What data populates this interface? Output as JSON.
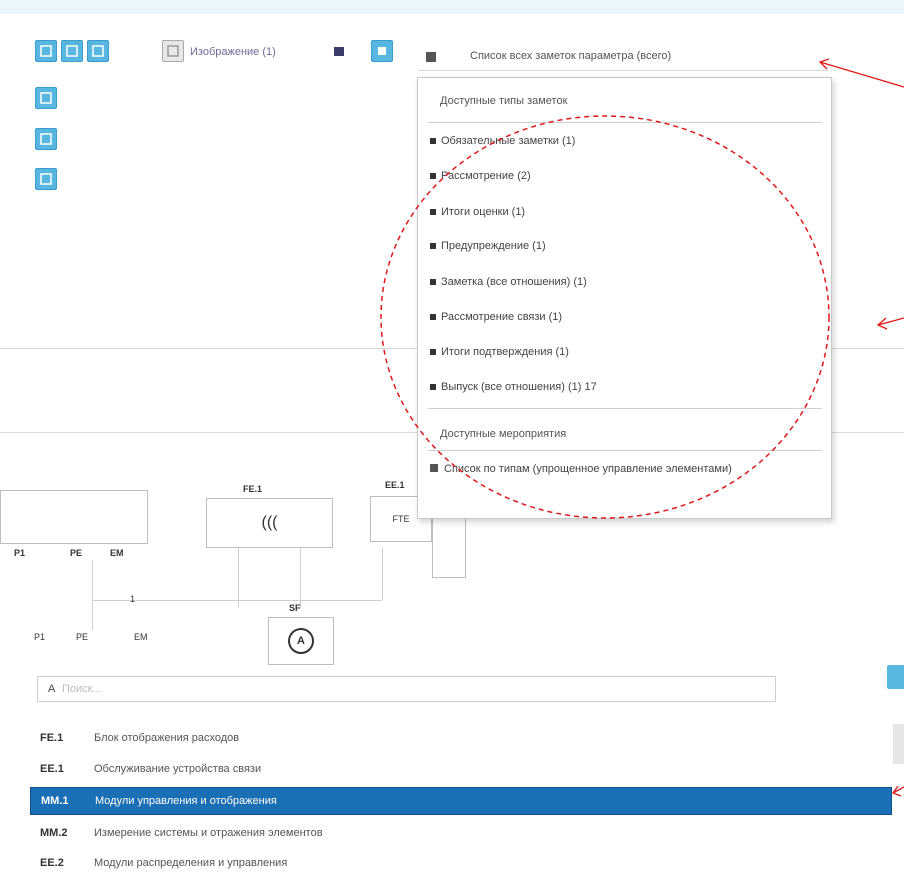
{
  "colors": {
    "accent": "#58b7e0",
    "selection": "#1b6fb4",
    "annotation_red": "#e01818"
  },
  "toolbar": {
    "buttons": [
      "square-icon",
      "square-icon",
      "square-icon"
    ],
    "side_buttons": [
      "square-icon",
      "square-icon",
      "square-icon"
    ],
    "grey_button_icon": "square-icon",
    "filter_label": "Изображение (1)",
    "dropdown_label": "Список всех заметок параметра (всего)"
  },
  "menu": {
    "header1": "Доступные типы заметок",
    "items": [
      "Обязательные заметки (1)",
      "Рассмотрение (2)",
      "Итоги оценки (1)",
      "Предупреждение (1)",
      "Заметка (все отношения) (1)",
      "Рассмотрение связи (1)",
      "Итоги подтверждения (1)",
      "Выпуск (все отношения) (1) 17"
    ],
    "header2": "Доступные мероприятия",
    "footer_item": "Список по типам (упрощенное управление элементами)"
  },
  "diagram": {
    "labels": {
      "a": "EE.1",
      "b": "FE.1",
      "c": "PE",
      "d": "SF",
      "e": "EM",
      "f": "P1",
      "g": "1"
    },
    "box_b_text": "(((",
    "box_c_text": "FTE",
    "box_d_text": "A"
  },
  "search": {
    "prefix": "A",
    "placeholder": "Поиск..."
  },
  "list": [
    {
      "code": "FE.1",
      "text": "Блок отображения расходов"
    },
    {
      "code": "EE.1",
      "text": "Обслуживание устройства связи"
    },
    {
      "code": "MM.1",
      "text": "Модули управления и отображения"
    },
    {
      "code": "MM.2",
      "text": "Измерение системы и отражения элементов"
    },
    {
      "code": "EE.2",
      "text": "Модули распределения и управления"
    }
  ],
  "selected_index": 2
}
